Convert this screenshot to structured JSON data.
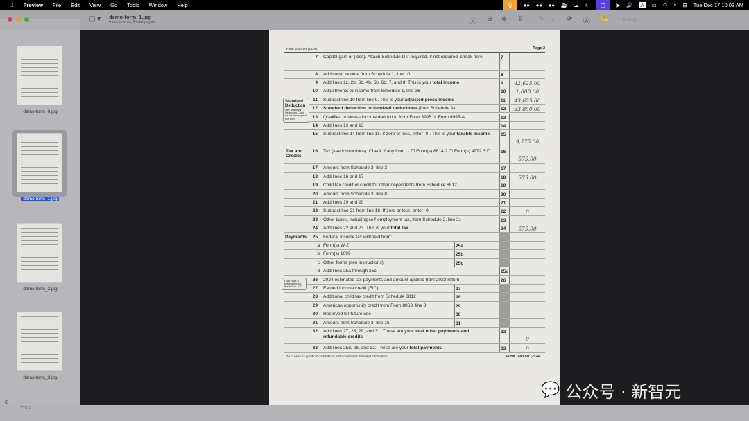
{
  "menubar": {
    "app": "Preview",
    "items": [
      "File",
      "Edit",
      "View",
      "Go",
      "Tools",
      "Window",
      "Help"
    ],
    "datetime": "Tue Dec 17  10:03 AM"
  },
  "window": {
    "title": "demo-form_1.jpg",
    "subtitle": "4 documents, 4 total pages",
    "search_placeholder": "Search"
  },
  "sidebar": {
    "items": [
      {
        "label": "demo-form_0.jpg",
        "selected": false
      },
      {
        "label": "demo-form_1.jpg",
        "selected": true
      },
      {
        "label": "demo-form_2.jpg",
        "selected": false
      },
      {
        "label": "demo-form_3.jpg",
        "selected": false
      }
    ]
  },
  "bottom": {
    "help": "Help"
  },
  "form": {
    "header_left": "Form 1040-SR (2024)",
    "header_right": "Page 2",
    "sections": {
      "standard": "Standard Deduction",
      "standard_note": "See Standard Deduction Chart on the last page of this form.",
      "tax": "Tax and Credits",
      "payments": "Payments",
      "eic_note": "If you have a qualifying child, attach Sch. EIC."
    },
    "rows": [
      {
        "num": "7",
        "text": "Capital gain or (loss). Attach Schedule D if required. If not required, check here",
        "box": "7",
        "amount": "",
        "double": true
      },
      {
        "num": "8",
        "text": "Additional income from Schedule 1, line 10",
        "box": "8",
        "amount": ""
      },
      {
        "num": "9",
        "text": "Add lines 1z, 2b, 3b, 4b, 5b, 6b, 7, and 8. This is your ",
        "bold": "total income",
        "box": "9",
        "amount": "42,625.00"
      },
      {
        "num": "10",
        "text": "Adjustments to income from Schedule 1, line 26",
        "box": "10",
        "amount": "1,000.00"
      },
      {
        "num": "11",
        "text": "Subtract line 10 from line 9. This is your ",
        "bold": "adjusted gross income",
        "box": "11",
        "amount": "43,625.00"
      },
      {
        "num": "12",
        "text": "",
        "bold": "Standard deduction or itemized deductions",
        "after": " (from Schedule A)",
        "box": "12",
        "amount": "33,850.00"
      },
      {
        "num": "13",
        "text": "Qualified business income deduction from Form 8995 or Form 8995-A",
        "box": "13",
        "amount": ""
      },
      {
        "num": "14",
        "text": "Add lines 12 and 13",
        "box": "14",
        "amount": ""
      },
      {
        "num": "15",
        "text": "Subtract line 14 from line 11. If zero or less, enter -0-. This is your ",
        "bold": "taxable income",
        "box": "15",
        "amount": "9,775.00",
        "double": true
      },
      {
        "num": "16",
        "text": "Tax (see instructions). Check if any from:  1 ☐ Form(s) 8814   2 ☐ Form(s) 4972   3 ☐ ________",
        "box": "16",
        "amount": "575.00",
        "double": true
      },
      {
        "num": "17",
        "text": "Amount from Schedule 2, line 3",
        "box": "17",
        "amount": ""
      },
      {
        "num": "18",
        "text": "Add lines 16 and 17",
        "box": "18",
        "amount": "575.00"
      },
      {
        "num": "19",
        "text": "Child tax credit or credit for other dependents from Schedule 8812",
        "box": "19",
        "amount": ""
      },
      {
        "num": "20",
        "text": "Amount from Schedule 3, line 8",
        "box": "20",
        "amount": ""
      },
      {
        "num": "21",
        "text": "Add lines 19 and 20",
        "box": "21",
        "amount": ""
      },
      {
        "num": "22",
        "text": "Subtract line 21 from line 18. If zero or less, enter -0-",
        "box": "22",
        "amount": "0"
      },
      {
        "num": "23",
        "text": "Other taxes, including self-employment tax, from Schedule 2, line 21",
        "box": "23",
        "amount": ""
      },
      {
        "num": "24",
        "text": "Add lines 22 and 23. This is your ",
        "bold": "total tax",
        "box": "24",
        "amount": "575.00"
      },
      {
        "num": "25",
        "text": "Federal income tax withheld from:",
        "shaded": true
      },
      {
        "sub": "a",
        "text": "Form(s) W-2",
        "ibox": "25a",
        "shaded": true
      },
      {
        "sub": "b",
        "text": "Form(s) 1099",
        "ibox": "25b",
        "shaded": true
      },
      {
        "sub": "c",
        "text": "Other forms (see instructions)",
        "ibox": "25c",
        "shaded": true
      },
      {
        "sub": "d",
        "text": "Add lines 25a through 25c",
        "box": "25d",
        "amount": ""
      },
      {
        "num": "26",
        "text": "2024 estimated tax payments and amount applied from 2023 return",
        "box": "26",
        "amount": ""
      },
      {
        "num": "27",
        "text": "Earned income credit (EIC)",
        "ibox": "27",
        "shaded": true
      },
      {
        "num": "28",
        "text": "Additional child tax credit from Schedule 8812",
        "ibox": "28",
        "shaded": true
      },
      {
        "num": "29",
        "text": "American opportunity credit from Form 8863, line 8",
        "ibox": "29",
        "shaded": true
      },
      {
        "num": "30",
        "text": "Reserved for future use",
        "ibox": "30",
        "shaded": true
      },
      {
        "num": "31",
        "text": "Amount from Schedule 3, line 15",
        "ibox": "31",
        "shaded": true
      },
      {
        "num": "32",
        "text": "Add lines 27, 28, 29, and 31. These are your ",
        "bold": "total other payments and refundable credits",
        "box": "32",
        "amount": "0",
        "double": true
      },
      {
        "num": "33",
        "text": "Add lines 25d, 26, and 32. These are your ",
        "bold": "total payments",
        "box": "33",
        "amount": "0"
      }
    ],
    "footer_left": "Go to www.irs.gov/Form1040SR for instructions and the latest information.",
    "footer_right": "Form 1040-SR (2024)"
  },
  "watermark": "公众号 · 新智元"
}
